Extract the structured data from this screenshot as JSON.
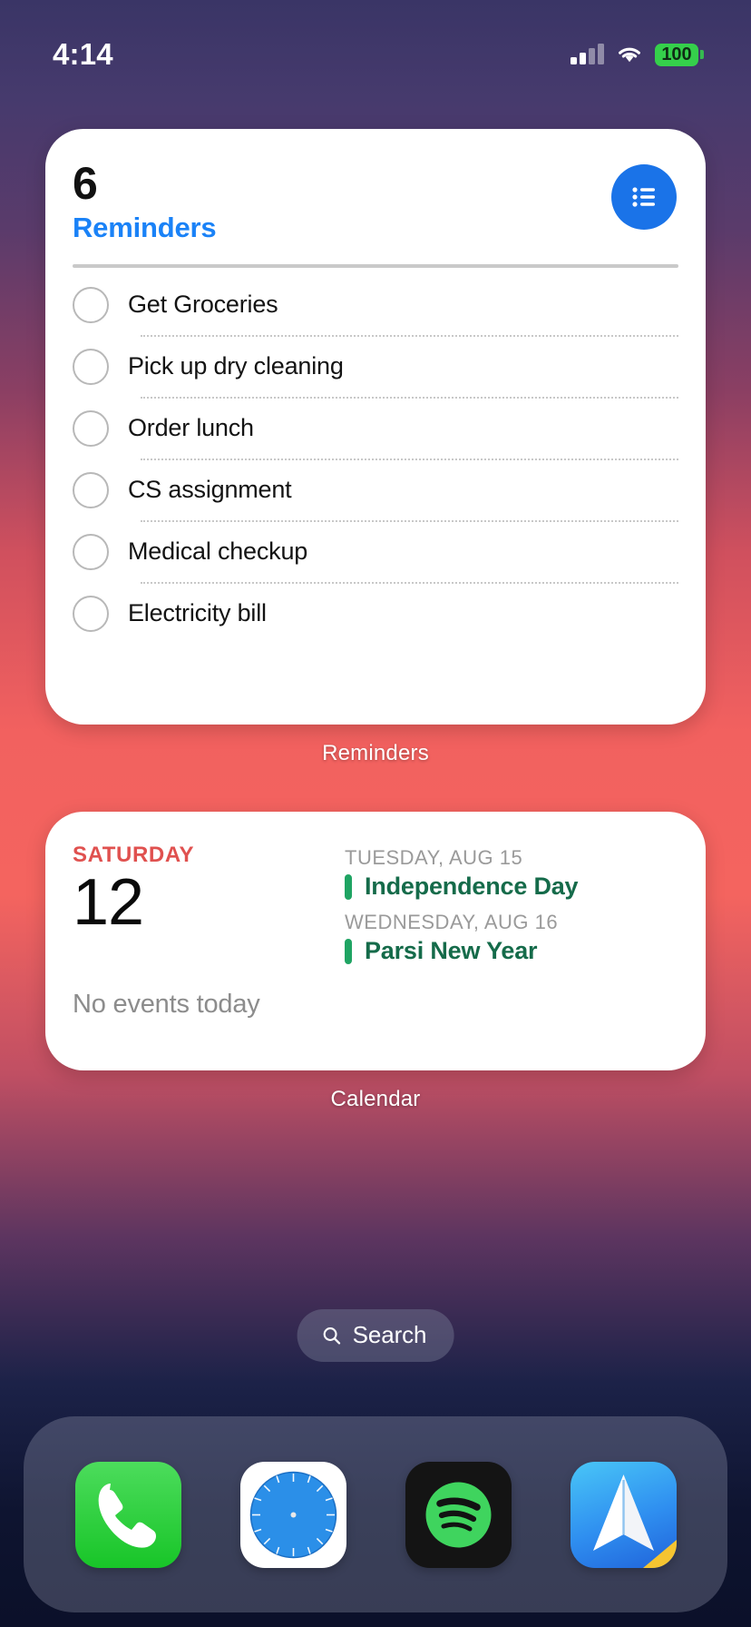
{
  "status_bar": {
    "time": "4:14",
    "signal_icon": "cellular-signal-icon",
    "wifi_icon": "wifi-icon",
    "battery_level": "100",
    "battery_icon": "battery-icon"
  },
  "widgets": {
    "reminders": {
      "caption": "Reminders",
      "count": "6",
      "title": "Reminders",
      "badge_icon": "list-bullet-icon",
      "items": [
        {
          "label": "Get Groceries",
          "checked": false
        },
        {
          "label": "Pick up dry cleaning",
          "checked": false
        },
        {
          "label": "Order lunch",
          "checked": false
        },
        {
          "label": "CS assignment",
          "checked": false
        },
        {
          "label": "Medical checkup",
          "checked": false
        },
        {
          "label": "Electricity bill",
          "checked": false
        }
      ]
    },
    "calendar": {
      "caption": "Calendar",
      "weekday": "SATURDAY",
      "day_number": "12",
      "no_events_text": "No events today",
      "upcoming": [
        {
          "date_label": "TUESDAY, AUG 15",
          "title": "Independence Day",
          "color": "#1fa463"
        },
        {
          "date_label": "WEDNESDAY, AUG 16",
          "title": "Parsi New Year",
          "color": "#1fa463"
        }
      ]
    }
  },
  "search": {
    "label": "Search",
    "icon": "search-icon"
  },
  "dock": {
    "apps": [
      {
        "name": "Phone",
        "icon": "phone-icon"
      },
      {
        "name": "Safari",
        "icon": "safari-compass-icon"
      },
      {
        "name": "Spotify",
        "icon": "spotify-icon"
      },
      {
        "name": "Spark",
        "icon": "paper-plane-icon"
      }
    ]
  },
  "colors": {
    "accent_blue": "#1a73e8",
    "reminders_title": "#1a82f7",
    "calendar_weekday": "#e0514f",
    "event_green": "#1fa463",
    "battery_green": "#35d04b"
  }
}
